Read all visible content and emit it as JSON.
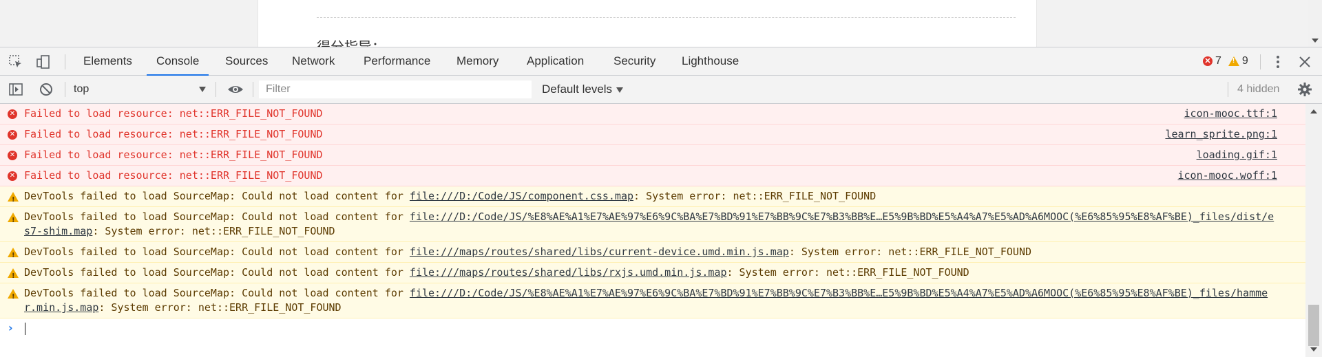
{
  "page": {
    "heading": "得分指导："
  },
  "tabbar": {
    "tabs": [
      {
        "label": "Elements",
        "active": false
      },
      {
        "label": "Console",
        "active": true
      },
      {
        "label": "Sources",
        "active": false
      },
      {
        "label": "Network",
        "active": false
      },
      {
        "label": "Performance",
        "active": false
      },
      {
        "label": "Memory",
        "active": false
      },
      {
        "label": "Application",
        "active": false
      },
      {
        "label": "Security",
        "active": false
      },
      {
        "label": "Lighthouse",
        "active": false
      }
    ],
    "error_count": "7",
    "warning_count": "9",
    "icons": [
      "inspect-icon",
      "device-toolbar-icon",
      "more-vertical-icon",
      "close-icon"
    ]
  },
  "toolbar": {
    "context": "top",
    "filter_placeholder": "Filter",
    "filter_value": "",
    "levels_label": "Default levels",
    "hidden_label": "4 hidden",
    "icons": [
      "sidebar-toggle-icon",
      "clear-console-icon",
      "eye-icon",
      "settings-gear-icon"
    ]
  },
  "colors": {
    "accent": "#1a73e8",
    "error_text": "#e0342b",
    "error_bg": "#fff0f0",
    "warning_bg": "#fffbe5",
    "warning_icon": "#f0a900"
  },
  "messages": [
    {
      "level": "error",
      "text": "Failed to load resource: net::ERR_FILE_NOT_FOUND",
      "source": "icon-mooc.ttf:1"
    },
    {
      "level": "error",
      "text": "Failed to load resource: net::ERR_FILE_NOT_FOUND",
      "source": "learn_sprite.png:1"
    },
    {
      "level": "error",
      "text": "Failed to load resource: net::ERR_FILE_NOT_FOUND",
      "source": "loading.gif:1"
    },
    {
      "level": "error",
      "text": "Failed to load resource: net::ERR_FILE_NOT_FOUND",
      "source": "icon-mooc.woff:1"
    },
    {
      "level": "warning",
      "prefix": "DevTools failed to load SourceMap: Could not load content for ",
      "link": "file:///D:/Code/JS/component.css.map",
      "suffix": ": System error: net::ERR_FILE_NOT_FOUND"
    },
    {
      "level": "warning",
      "prefix": "DevTools failed to load SourceMap: Could not load content for ",
      "link": "file:///D:/Code/JS/%E8%AE%A1%E7%AE%97%E6%9C%BA%E7%BD%91%E7%BB%9C%E7%B3%BB%E…E5%9B%BD%E5%A4%A7%E5%AD%A6MOOC(%E6%85%95%E8%AF%BE)_files/dist/es7-shim.map",
      "suffix": ": System error: net::ERR_FILE_NOT_FOUND"
    },
    {
      "level": "warning",
      "prefix": "DevTools failed to load SourceMap: Could not load content for ",
      "link": "file:///maps/routes/shared/libs/current-device.umd.min.js.map",
      "suffix": ": System error: net::ERR_FILE_NOT_FOUND"
    },
    {
      "level": "warning",
      "prefix": "DevTools failed to load SourceMap: Could not load content for ",
      "link": "file:///maps/routes/shared/libs/rxjs.umd.min.js.map",
      "suffix": ": System error: net::ERR_FILE_NOT_FOUND"
    },
    {
      "level": "warning",
      "prefix": "DevTools failed to load SourceMap: Could not load content for ",
      "link": "file:///D:/Code/JS/%E8%AE%A1%E7%AE%97%E6%9C%BA%E7%BD%91%E7%BB%9C%E7%B3%BB%E…E5%9B%BD%E5%A4%A7%E5%AD%A6MOOC(%E6%85%95%E8%AF%BE)_files/hammer.min.js.map",
      "suffix": ": System error: net::ERR_FILE_NOT_FOUND"
    }
  ]
}
